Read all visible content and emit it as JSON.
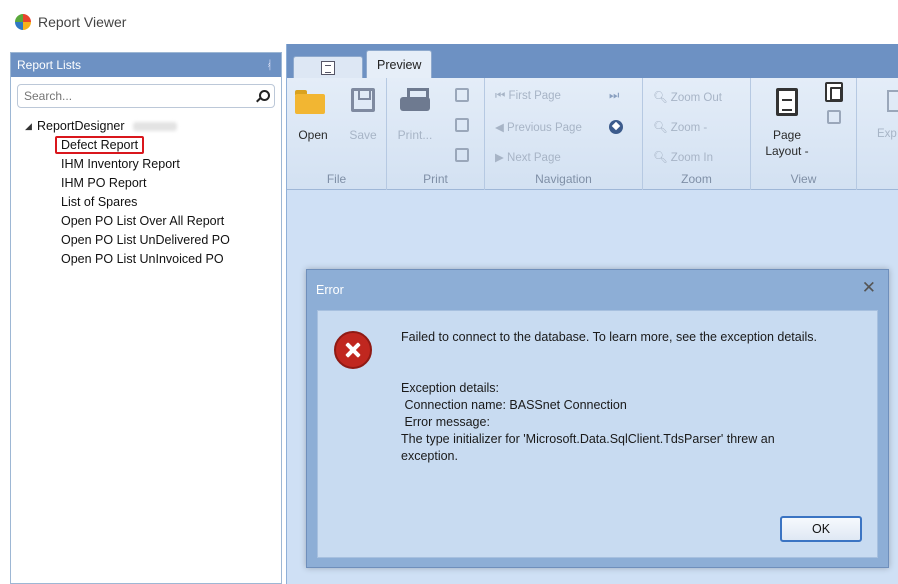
{
  "window": {
    "title": "Report Viewer"
  },
  "left_panel": {
    "title": "Report Lists",
    "pin_glyph": "ᚮ",
    "search": {
      "placeholder": "Search...",
      "value": ""
    },
    "tree": {
      "root": "ReportDesigner",
      "items": [
        "Defect Report",
        "IHM Inventory Report",
        "IHM PO Report",
        "List of Spares",
        "Open PO List Over All Report",
        "Open PO List UnDelivered PO",
        "Open PO List UnInvoiced PO"
      ],
      "selected_index": 0
    }
  },
  "tabs": {
    "preview_label": "Preview"
  },
  "ribbon": {
    "file": {
      "label": "File",
      "open": "Open",
      "save": "Save"
    },
    "print": {
      "label": "Print",
      "print": "Print..."
    },
    "navigation": {
      "label": "Navigation",
      "first_page": "First Page",
      "previous_page": "Previous Page",
      "next_page": "Next Page"
    },
    "zoom": {
      "label": "Zoom",
      "zoom_out": "Zoom Out",
      "zoom": "Zoom -",
      "zoom_in": "Zoom In"
    },
    "view": {
      "label": "View",
      "page_layout_1": "Page",
      "page_layout_2": "Layout -"
    },
    "export": {
      "label_partial": "Exp"
    }
  },
  "dialog": {
    "title": "Error",
    "close_glyph": "✕",
    "message": "Failed to connect to the database. To learn more, see the exception details.",
    "details_header": "Exception details:",
    "connection_name": " Connection name: BASSnet Connection",
    "error_message_label": " Error message:",
    "error_text_1": "The type initializer for 'Microsoft.Data.SqlClient.TdsParser' threw an",
    "error_text_2": "exception.",
    "ok_label": "OK"
  },
  "colors": {
    "panel_header": "#6d91c3",
    "ribbon_bg": "#d3e1f2",
    "dialog_frame": "#8daed6",
    "dialog_body": "#c8dbf1",
    "error_red": "#c0271f",
    "selection_outline": "#d9161c"
  },
  "icons": [
    "app-logo-icon",
    "pin-icon",
    "search-icon",
    "open-folder-icon",
    "save-icon",
    "printer-icon",
    "document-icon",
    "error-icon",
    "close-icon"
  ]
}
